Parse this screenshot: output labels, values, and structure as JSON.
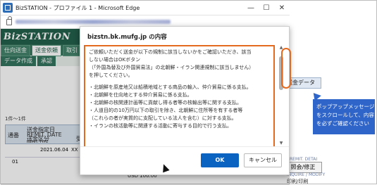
{
  "window": {
    "title": "BizSTATION - プロファイル 1 - Microsoft Edge",
    "controls": {
      "minimize": "—",
      "maximize": "☐",
      "close": "✕"
    }
  },
  "app": {
    "logo": "BizSTATION",
    "nav_tabs": [
      "仕向送金",
      "送金依頼",
      "取引"
    ],
    "sub_tabs": [
      "データ作成",
      "承認"
    ],
    "right_tab_partial": "送金データ"
  },
  "background_table": {
    "count_text": "1件～1件",
    "col_seq": "通番",
    "col_date": "送金指定日",
    "col_date_sub": "REMIT. DATE",
    "col_type": "送金区分",
    "col_type_sub": "REMIT. TYPE",
    "col_cut": "受",
    "row_date": "2021.06.04",
    "row_type": "XX",
    "row_seq": "01",
    "usd_text": "USD  100.00",
    "right_button": "照会/修正",
    "right_sub0": "REMIT. DETAI",
    "right_sub": "INQUIRE / MODIFY",
    "right_text": "印刷/印刷"
  },
  "dialog": {
    "title": "bizstn.bk.mufg.jp の内容",
    "message_lines": [
      "ご依頼いただく送金が以下の規制に該当しないかをご確認いただき、該当",
      "しない場合はOKボタン",
      "（「外国為替及び外国貿易法」の北朝鮮・イラン関連規制に該当しません）",
      "を押してください。",
      "",
      "・北朝鮮を原産地又は船積地域とする商品の輸入、仲介貿易に係る支払。",
      "・北朝鮮を仕向地とする仲介貿易に係る支払。",
      "・北朝鮮の核関連計画等に貢献し得る者等の核輸出等に関する支払。",
      "・人道目的の10万円以下の取引を除き、北朝鮮に住所等を有する者等",
      "（これらの者が実質的に支配している法人を含む）に対する支払。",
      "・イランの核活動等に関連する活動に寄与する目的で行う支払。"
    ],
    "ok_label": "OK",
    "cancel_label": "キャンセル"
  },
  "callout": {
    "lines": [
      "ポップアップメッセージ",
      "をスクロールして、内容",
      "を必ずご確認ください"
    ]
  },
  "colors": {
    "brand_green": "#1c5b46",
    "highlight_orange": "#e36a1e",
    "callout_blue": "#2f64c8",
    "ok_blue": "#0b63c1"
  }
}
